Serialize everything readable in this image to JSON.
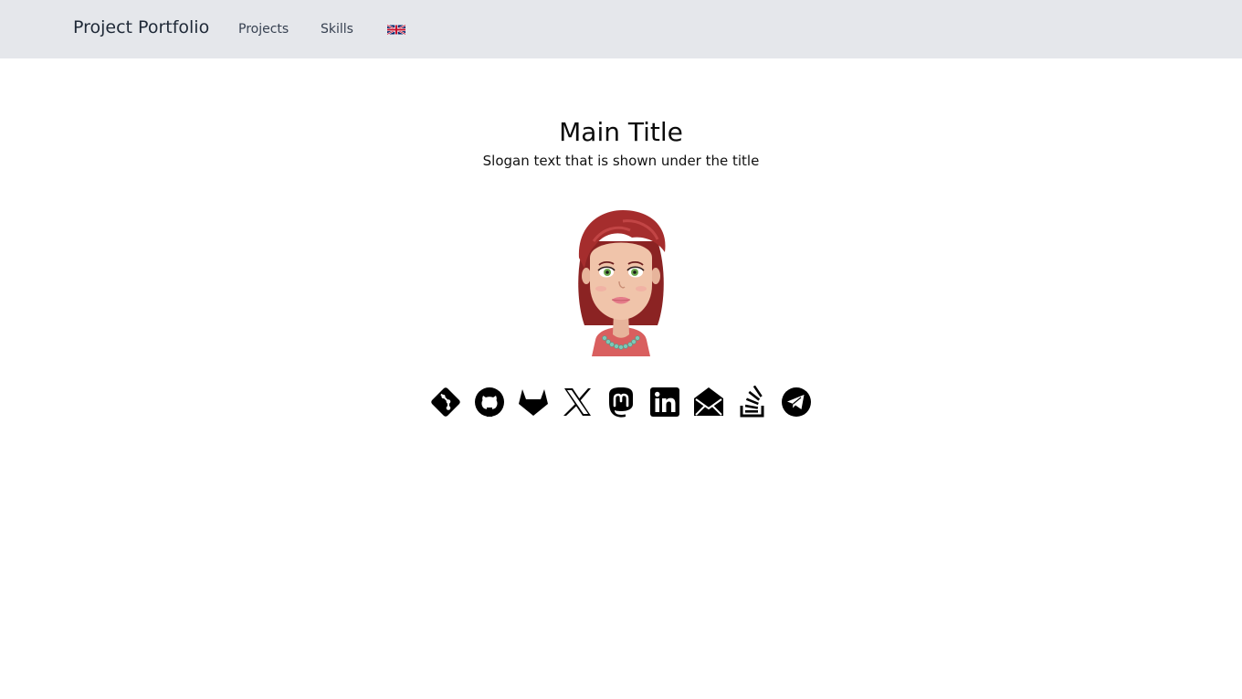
{
  "navbar": {
    "brand": "Project Portfolio",
    "links": [
      "Projects",
      "Skills"
    ],
    "language_icon": "uk-flag-icon"
  },
  "hero": {
    "title": "Main Title",
    "slogan": "Slogan text that is shown under the title",
    "avatar_icon": "cartoon-woman-avatar"
  },
  "social_icons": [
    "git-icon",
    "github-icon",
    "gitlab-icon",
    "x-twitter-icon",
    "mastodon-icon",
    "linkedin-icon",
    "email-icon",
    "stackoverflow-icon",
    "telegram-icon"
  ],
  "colors": {
    "navbar_bg": "#e5e7eb",
    "icon": "#000000"
  }
}
